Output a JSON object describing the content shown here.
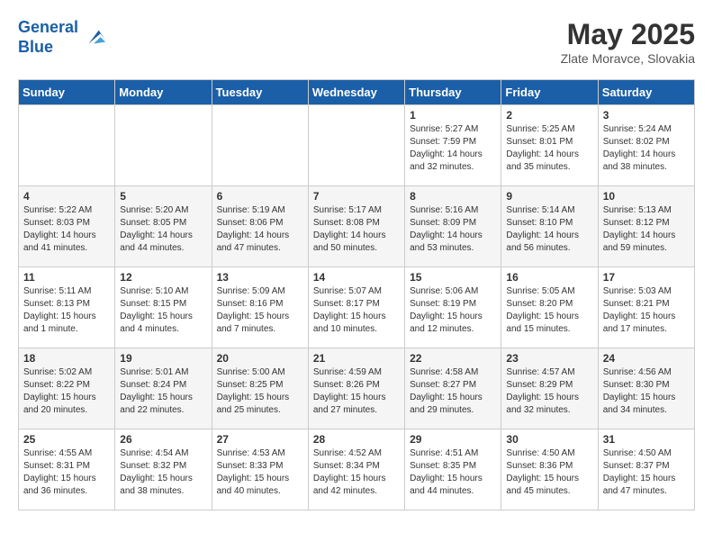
{
  "header": {
    "logo_line1": "General",
    "logo_line2": "Blue",
    "month": "May 2025",
    "location": "Zlate Moravce, Slovakia"
  },
  "days_of_week": [
    "Sunday",
    "Monday",
    "Tuesday",
    "Wednesday",
    "Thursday",
    "Friday",
    "Saturday"
  ],
  "weeks": [
    [
      {
        "day": "",
        "info": ""
      },
      {
        "day": "",
        "info": ""
      },
      {
        "day": "",
        "info": ""
      },
      {
        "day": "",
        "info": ""
      },
      {
        "day": "1",
        "info": "Sunrise: 5:27 AM\nSunset: 7:59 PM\nDaylight: 14 hours\nand 32 minutes."
      },
      {
        "day": "2",
        "info": "Sunrise: 5:25 AM\nSunset: 8:01 PM\nDaylight: 14 hours\nand 35 minutes."
      },
      {
        "day": "3",
        "info": "Sunrise: 5:24 AM\nSunset: 8:02 PM\nDaylight: 14 hours\nand 38 minutes."
      }
    ],
    [
      {
        "day": "4",
        "info": "Sunrise: 5:22 AM\nSunset: 8:03 PM\nDaylight: 14 hours\nand 41 minutes."
      },
      {
        "day": "5",
        "info": "Sunrise: 5:20 AM\nSunset: 8:05 PM\nDaylight: 14 hours\nand 44 minutes."
      },
      {
        "day": "6",
        "info": "Sunrise: 5:19 AM\nSunset: 8:06 PM\nDaylight: 14 hours\nand 47 minutes."
      },
      {
        "day": "7",
        "info": "Sunrise: 5:17 AM\nSunset: 8:08 PM\nDaylight: 14 hours\nand 50 minutes."
      },
      {
        "day": "8",
        "info": "Sunrise: 5:16 AM\nSunset: 8:09 PM\nDaylight: 14 hours\nand 53 minutes."
      },
      {
        "day": "9",
        "info": "Sunrise: 5:14 AM\nSunset: 8:10 PM\nDaylight: 14 hours\nand 56 minutes."
      },
      {
        "day": "10",
        "info": "Sunrise: 5:13 AM\nSunset: 8:12 PM\nDaylight: 14 hours\nand 59 minutes."
      }
    ],
    [
      {
        "day": "11",
        "info": "Sunrise: 5:11 AM\nSunset: 8:13 PM\nDaylight: 15 hours\nand 1 minute."
      },
      {
        "day": "12",
        "info": "Sunrise: 5:10 AM\nSunset: 8:15 PM\nDaylight: 15 hours\nand 4 minutes."
      },
      {
        "day": "13",
        "info": "Sunrise: 5:09 AM\nSunset: 8:16 PM\nDaylight: 15 hours\nand 7 minutes."
      },
      {
        "day": "14",
        "info": "Sunrise: 5:07 AM\nSunset: 8:17 PM\nDaylight: 15 hours\nand 10 minutes."
      },
      {
        "day": "15",
        "info": "Sunrise: 5:06 AM\nSunset: 8:19 PM\nDaylight: 15 hours\nand 12 minutes."
      },
      {
        "day": "16",
        "info": "Sunrise: 5:05 AM\nSunset: 8:20 PM\nDaylight: 15 hours\nand 15 minutes."
      },
      {
        "day": "17",
        "info": "Sunrise: 5:03 AM\nSunset: 8:21 PM\nDaylight: 15 hours\nand 17 minutes."
      }
    ],
    [
      {
        "day": "18",
        "info": "Sunrise: 5:02 AM\nSunset: 8:22 PM\nDaylight: 15 hours\nand 20 minutes."
      },
      {
        "day": "19",
        "info": "Sunrise: 5:01 AM\nSunset: 8:24 PM\nDaylight: 15 hours\nand 22 minutes."
      },
      {
        "day": "20",
        "info": "Sunrise: 5:00 AM\nSunset: 8:25 PM\nDaylight: 15 hours\nand 25 minutes."
      },
      {
        "day": "21",
        "info": "Sunrise: 4:59 AM\nSunset: 8:26 PM\nDaylight: 15 hours\nand 27 minutes."
      },
      {
        "day": "22",
        "info": "Sunrise: 4:58 AM\nSunset: 8:27 PM\nDaylight: 15 hours\nand 29 minutes."
      },
      {
        "day": "23",
        "info": "Sunrise: 4:57 AM\nSunset: 8:29 PM\nDaylight: 15 hours\nand 32 minutes."
      },
      {
        "day": "24",
        "info": "Sunrise: 4:56 AM\nSunset: 8:30 PM\nDaylight: 15 hours\nand 34 minutes."
      }
    ],
    [
      {
        "day": "25",
        "info": "Sunrise: 4:55 AM\nSunset: 8:31 PM\nDaylight: 15 hours\nand 36 minutes."
      },
      {
        "day": "26",
        "info": "Sunrise: 4:54 AM\nSunset: 8:32 PM\nDaylight: 15 hours\nand 38 minutes."
      },
      {
        "day": "27",
        "info": "Sunrise: 4:53 AM\nSunset: 8:33 PM\nDaylight: 15 hours\nand 40 minutes."
      },
      {
        "day": "28",
        "info": "Sunrise: 4:52 AM\nSunset: 8:34 PM\nDaylight: 15 hours\nand 42 minutes."
      },
      {
        "day": "29",
        "info": "Sunrise: 4:51 AM\nSunset: 8:35 PM\nDaylight: 15 hours\nand 44 minutes."
      },
      {
        "day": "30",
        "info": "Sunrise: 4:50 AM\nSunset: 8:36 PM\nDaylight: 15 hours\nand 45 minutes."
      },
      {
        "day": "31",
        "info": "Sunrise: 4:50 AM\nSunset: 8:37 PM\nDaylight: 15 hours\nand 47 minutes."
      }
    ]
  ]
}
